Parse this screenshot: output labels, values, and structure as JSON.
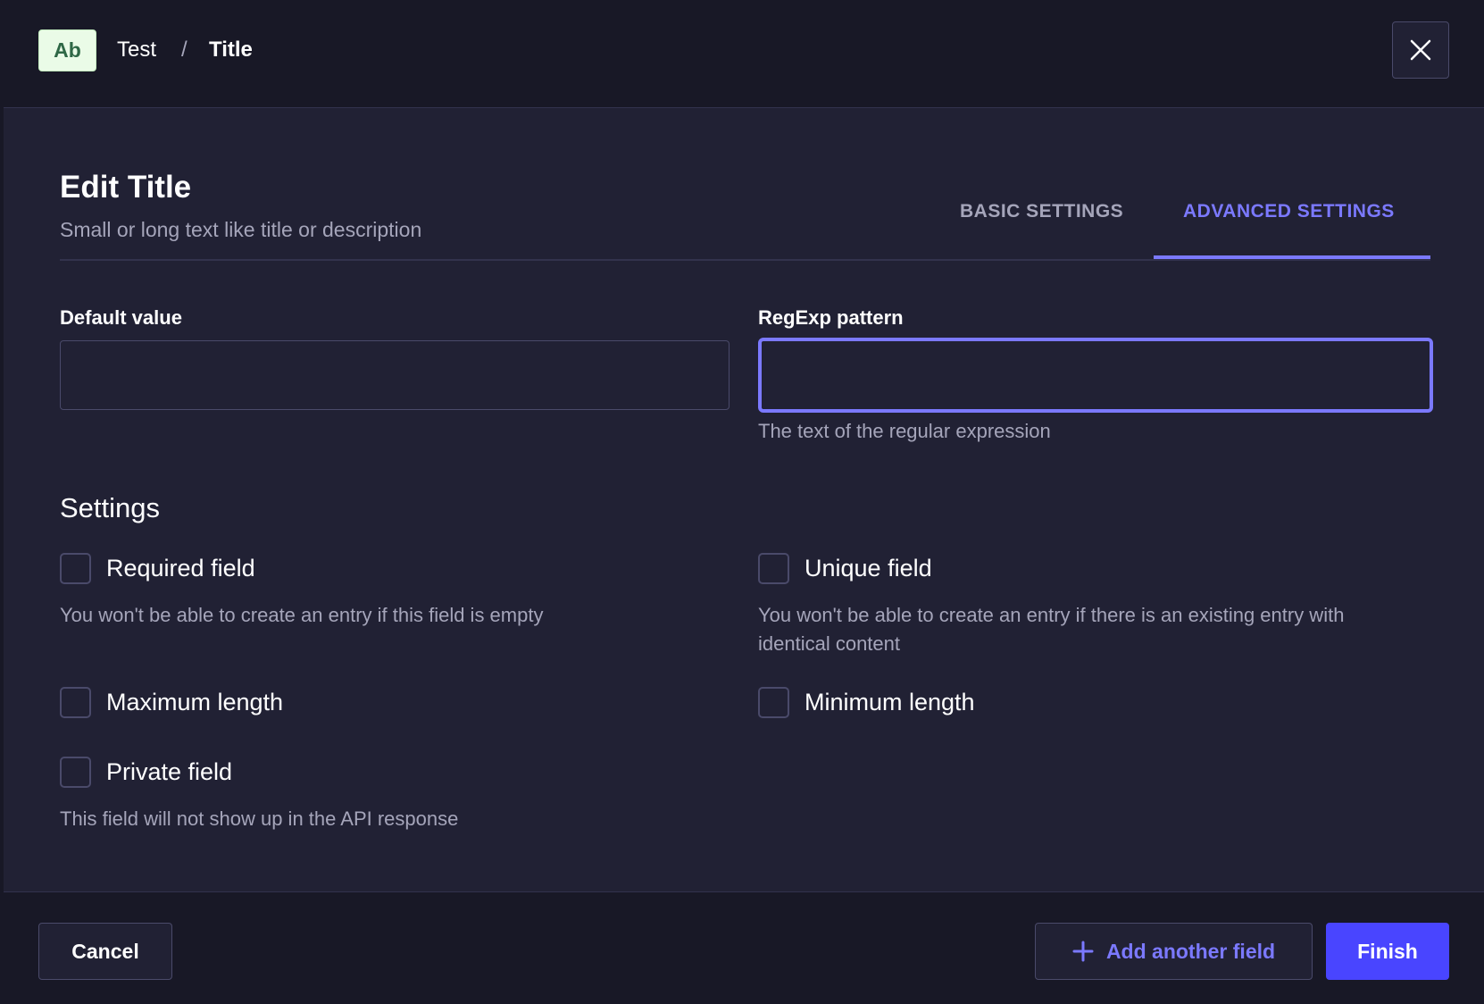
{
  "header": {
    "badge": "Ab",
    "breadcrumb": {
      "parent": "Test",
      "separator": "/",
      "current": "Title"
    }
  },
  "main": {
    "title": "Edit Title",
    "subtitle": "Small or long text like title or description",
    "tabs": [
      {
        "label": "BASIC SETTINGS",
        "active": false
      },
      {
        "label": "ADVANCED SETTINGS",
        "active": true
      }
    ],
    "default_value": {
      "label": "Default value",
      "value": ""
    },
    "regexp": {
      "label": "RegExp pattern",
      "value": "",
      "hint": "The text of the regular expression"
    },
    "settings": {
      "title": "Settings",
      "options": [
        {
          "label": "Required field",
          "checked": false,
          "hint": "You won't be able to create an entry if this field is empty"
        },
        {
          "label": "Unique field",
          "checked": false,
          "hint": "You won't be able to create an entry if there is an existing entry with identical content"
        },
        {
          "label": "Maximum length",
          "checked": false
        },
        {
          "label": "Minimum length",
          "checked": false
        },
        {
          "label": "Private field",
          "checked": false,
          "hint": "This field will not show up in the API response"
        }
      ]
    }
  },
  "footer": {
    "cancel_label": "Cancel",
    "add_label": "Add another field",
    "finish_label": "Finish"
  },
  "colors": {
    "accent": "#7b79ff",
    "primary_button": "#4945ff",
    "background": "#212134",
    "header_background": "#181826"
  },
  "icons": {
    "close": "close-icon",
    "add": "plus-icon"
  }
}
